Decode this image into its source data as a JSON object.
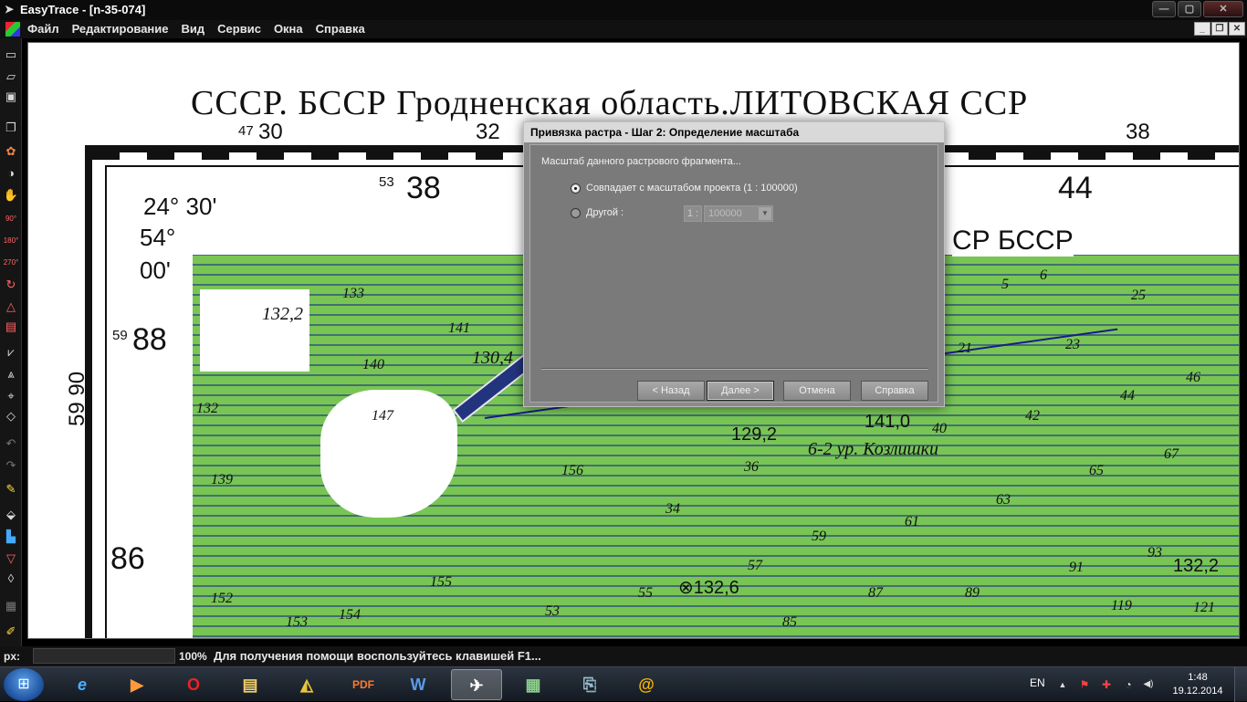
{
  "window": {
    "title": "EasyTrace - [n-35-074]",
    "controls": {
      "minimize": "—",
      "maximize": "▢",
      "close": "✕"
    }
  },
  "menubar": {
    "items": [
      "Файл",
      "Редактирование",
      "Вид",
      "Сервис",
      "Окна",
      "Справка"
    ],
    "mdi_controls": {
      "minimize": "_",
      "restore": "❐",
      "close": "✕"
    }
  },
  "toolbar": {
    "tools": [
      "new-file-icon",
      "open-file-icon",
      "save-icon",
      "copy-icon",
      "color-palette-icon",
      "globe-icon",
      "hand-icon",
      "rotate-90-icon",
      "rotate-180-icon",
      "rotate-270-icon",
      "rotate-icon",
      "triangle-icon",
      "frame-icon",
      "pyramid-icon",
      "layers-icon",
      "crosshair-icon",
      "select-icon",
      "undo-icon",
      "redo-icon",
      "brush-icon",
      "fill-icon",
      "histogram-icon",
      "filter-icon",
      "drop-icon",
      "grid-icon",
      "pencil-icon"
    ],
    "rotate_labels": {
      "r90": "90°",
      "r180": "180°",
      "r270": "270°"
    }
  },
  "map": {
    "header": "СССР. БССР Гродненская область.ЛИТОВСКАЯ ССР",
    "labels": {
      "top_47": "47",
      "top_30": "30",
      "top_32": "32",
      "top_38": "38",
      "c53": "53",
      "c38": "38",
      "c44": "44",
      "lat1": "24° 30'",
      "lat2": "54°",
      "lat3": "00'",
      "c59a": "59",
      "c88": "88",
      "c5990": "59 90",
      "c86": "86",
      "ssr": "СР БССР",
      "h1322": "132,2",
      "h133": "133",
      "h141": "141",
      "h1304": "130,4",
      "h140": "140",
      "h132": "132",
      "h147": "147",
      "h139": "139",
      "h156": "156",
      "h155": "155",
      "h152": "152",
      "h153": "153",
      "h154": "154",
      "h1292": "129,2",
      "h1410": "141,0",
      "kozl": "6-2 ур. Козлишки",
      "h36": "36",
      "h34": "34",
      "h59": "59",
      "h57": "57",
      "h1326": "⊗132,6",
      "h55": "55",
      "h53": "53",
      "h85": "85",
      "h87": "87",
      "h89": "89",
      "h61": "61",
      "h63": "63",
      "h65": "65",
      "h67": "67",
      "h42": "42",
      "h44": "44",
      "h46": "46",
      "h23": "23",
      "h21": "21",
      "h25": "25",
      "h93": "93",
      "h1322b": "132,2",
      "h91": "91",
      "h119": "119",
      "h121": "121",
      "h40": "40",
      "h5": "5",
      "h6": "6"
    }
  },
  "dialog": {
    "title": "Привязка растра - Шаг 2: Определение масштаба",
    "section_label": "Масштаб данного растрового фрагмента...",
    "option_project": "Совпадает с масштабом проекта (1 : 100000)",
    "option_other": "Другой :",
    "scale_prefix": "1 :",
    "scale_value": "100000",
    "buttons": {
      "back": "< Назад",
      "next": "Далее >",
      "cancel": "Отмена",
      "help": "Справка"
    }
  },
  "statusbar": {
    "px_label": "px:",
    "zoom": "100%",
    "message": "Для получения помощи воспользуйтесь клавишей F1..."
  },
  "taskbar": {
    "tasks": [
      "internet-explorer-icon",
      "media-player-icon",
      "opera-icon",
      "file-explorer-icon",
      "easytrace-icon",
      "pdf-icon",
      "word-icon",
      "paper-plane-icon",
      "photo-viewer-icon",
      "network-icon",
      "email-icon"
    ],
    "task_glyphs": {
      "ie": "e",
      "media": "▶",
      "opera": "O",
      "explorer": "▤",
      "easytrace": "◭",
      "pdf": "PDF",
      "word": "W",
      "plane": "✈",
      "photo": "▦",
      "network": "⎘",
      "email": "@"
    },
    "language": "EN",
    "tray_icons": {
      "arrow": "▲",
      "flag": "⚑",
      "security": "✚",
      "wifi": "◔",
      "volume": "◀)"
    },
    "time": "1:48",
    "date": "19.12.2014"
  }
}
